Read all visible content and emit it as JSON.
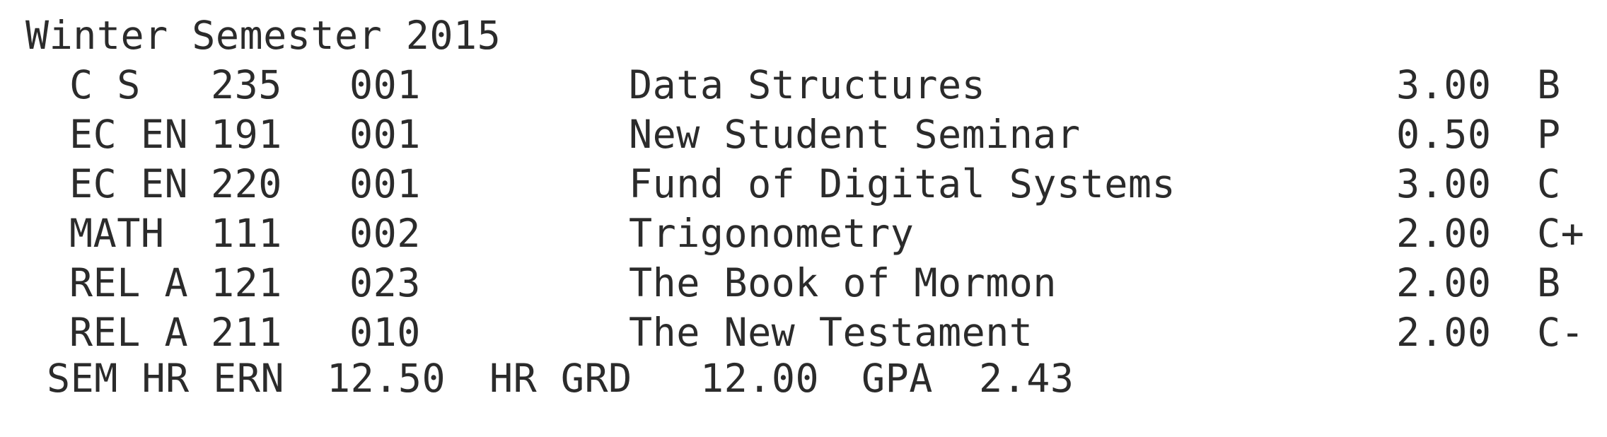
{
  "term": {
    "title": "Winter Semester 2015"
  },
  "courses": [
    {
      "dept": "C S",
      "number": "235",
      "section": "001",
      "title": "Data Structures",
      "hours": "3.00",
      "grade": "B"
    },
    {
      "dept": "EC EN",
      "number": "191",
      "section": "001",
      "title": "New Student Seminar",
      "hours": "0.50",
      "grade": "P"
    },
    {
      "dept": "EC EN",
      "number": "220",
      "section": "001",
      "title": "Fund of Digital Systems",
      "hours": "3.00",
      "grade": "C"
    },
    {
      "dept": "MATH",
      "number": "111",
      "section": "002",
      "title": "Trigonometry",
      "hours": "2.00",
      "grade": "C+"
    },
    {
      "dept": "REL A",
      "number": "121",
      "section": "023",
      "title": "The Book of Mormon",
      "hours": "2.00",
      "grade": "B"
    },
    {
      "dept": "REL A",
      "number": "211",
      "section": "010",
      "title": "The New Testament",
      "hours": "2.00",
      "grade": "C-"
    }
  ],
  "summary": {
    "hours_earned_label": "SEM HR ERN",
    "hours_earned": "12.50",
    "hours_graded_label": "HR GRD",
    "hours_graded": "12.00",
    "gpa_label": "GPA",
    "gpa": "2.43"
  }
}
